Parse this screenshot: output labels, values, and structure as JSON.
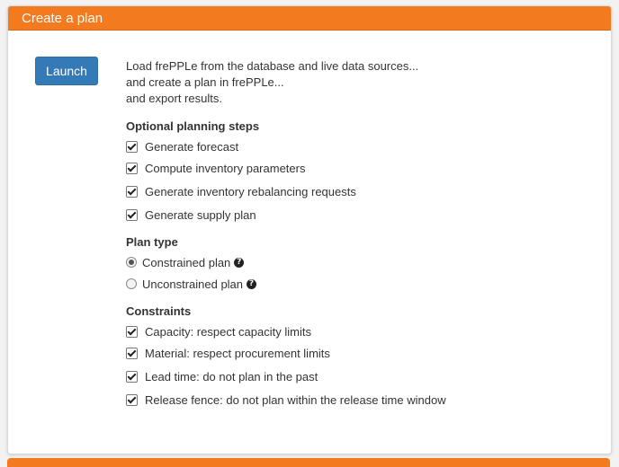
{
  "panel": {
    "title": "Create a plan",
    "launch_label": "Launch",
    "description": [
      "Load frePPLe from the database and live data sources...",
      "and create a plan in frePPLe...",
      "and export results."
    ]
  },
  "optional_steps": {
    "title": "Optional planning steps",
    "items": [
      {
        "label": "Generate forecast",
        "checked": true
      },
      {
        "label": "Compute inventory parameters",
        "checked": true
      },
      {
        "label": "Generate inventory rebalancing requests",
        "checked": true
      },
      {
        "label": "Generate supply plan",
        "checked": true
      }
    ]
  },
  "plan_type": {
    "title": "Plan type",
    "options": [
      {
        "label": "Constrained plan",
        "selected": true
      },
      {
        "label": "Unconstrained plan",
        "selected": false
      }
    ],
    "help_glyph": "?"
  },
  "constraints": {
    "title": "Constraints",
    "items": [
      {
        "label": "Capacity: respect capacity limits",
        "checked": true
      },
      {
        "label": "Material: respect procurement limits",
        "checked": true
      },
      {
        "label": "Lead time: do not plan in the past",
        "checked": true
      },
      {
        "label": "Release fence: do not plan within the release time window",
        "checked": true
      }
    ]
  },
  "colors": {
    "header": "#f47a20",
    "button": "#337ab7"
  },
  "icons": {
    "help": "question-circle-icon",
    "checkbox": "checkbox-icon",
    "radio": "radio-icon"
  }
}
